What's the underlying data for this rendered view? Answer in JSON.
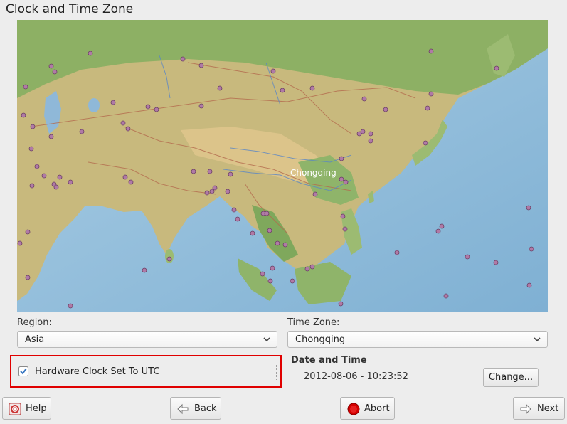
{
  "page": {
    "title": "Clock and Time Zone"
  },
  "map": {
    "selected_city": "Chongqing"
  },
  "region": {
    "label": "Region:",
    "value": "Asia"
  },
  "timezone": {
    "label": "Time Zone:",
    "value": "Chongqing"
  },
  "hardware_clock": {
    "label": "Hardware Clock Set To UTC",
    "checked": true
  },
  "date_time": {
    "title": "Date and Time",
    "value": "2012-08-06 - 10:23:52",
    "change_label": "Change..."
  },
  "buttons": {
    "help": "Help",
    "back": "Back",
    "abort": "Abort",
    "next": "Next"
  }
}
